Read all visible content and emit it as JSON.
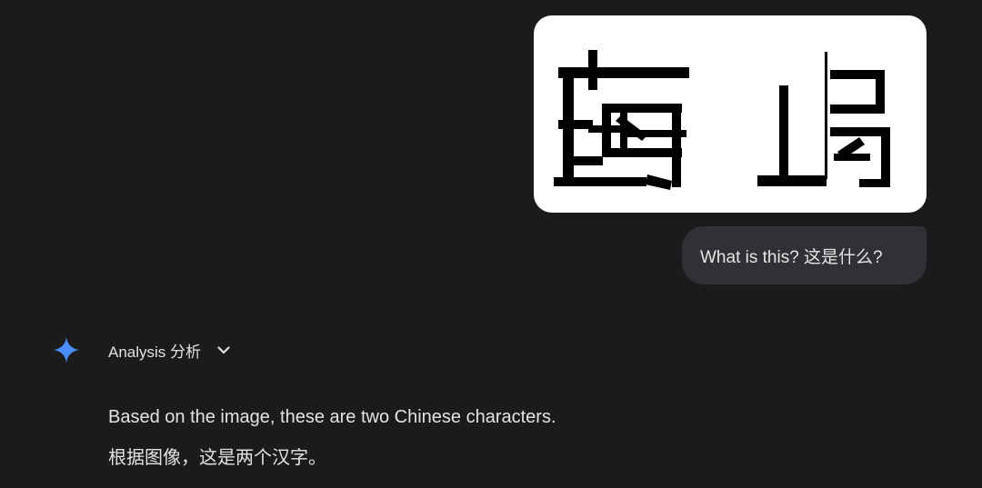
{
  "conversation": {
    "user_image": {
      "alt": "image of two stylized Chinese characters"
    },
    "user_message": "What is this?  这是什么?",
    "response": {
      "analysis_label": "Analysis  分析",
      "paragraphs": [
        "Based on the image, these are two Chinese characters.",
        "根据图像，这是两个汉字。"
      ]
    }
  },
  "colors": {
    "background": "#1b1b1d",
    "bubble": "#303134",
    "sparkle": "#4b8df8",
    "text": "#e3e3e3"
  },
  "icons": {
    "sparkle": "gemini-sparkle-icon",
    "chevron": "chevron-down-icon"
  }
}
